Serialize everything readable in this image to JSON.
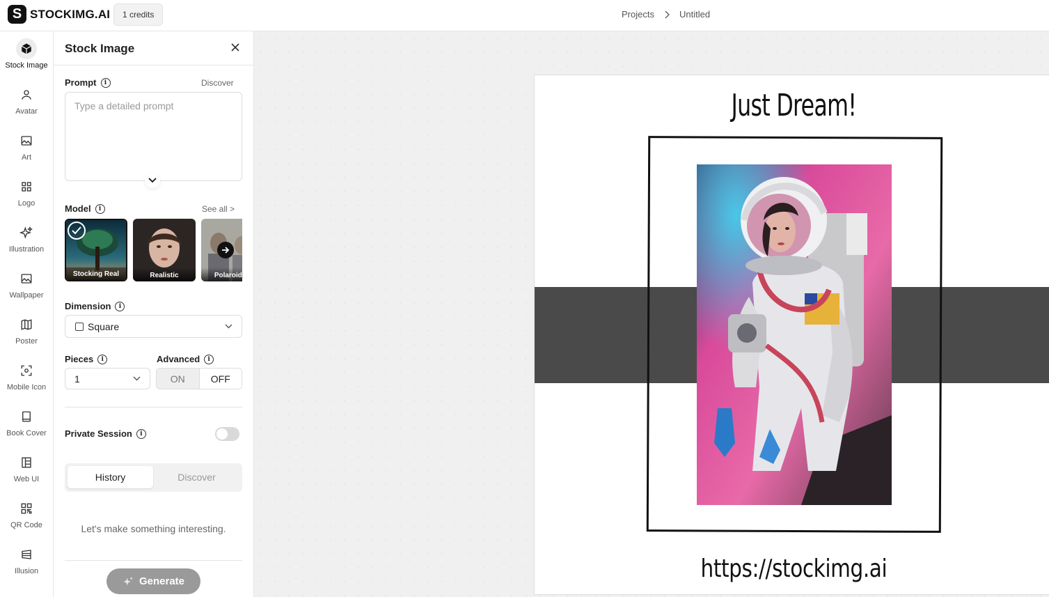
{
  "header": {
    "brand": "STOCKIMG.AI",
    "brand_mark": "S",
    "credits": "1 credits",
    "breadcrumb": [
      "Projects",
      "Untitled"
    ]
  },
  "rail": {
    "items": [
      {
        "label": "Stock Image",
        "icon": "cube-icon",
        "active": true
      },
      {
        "label": "Avatar",
        "icon": "user-icon",
        "active": false
      },
      {
        "label": "Art",
        "icon": "image-icon",
        "active": false
      },
      {
        "label": "Logo",
        "icon": "grid-icon",
        "active": false
      },
      {
        "label": "Illustration",
        "icon": "sparkles-icon",
        "active": false
      },
      {
        "label": "Wallpaper",
        "icon": "image-icon",
        "active": false
      },
      {
        "label": "Poster",
        "icon": "map-icon",
        "active": false
      },
      {
        "label": "Mobile Icon",
        "icon": "scan-icon",
        "active": false
      },
      {
        "label": "Book Cover",
        "icon": "book-icon",
        "active": false
      },
      {
        "label": "Web UI",
        "icon": "layout-icon",
        "active": false
      },
      {
        "label": "QR Code",
        "icon": "qr-icon",
        "active": false
      },
      {
        "label": "Illusion",
        "icon": "illusion-icon",
        "active": false
      }
    ]
  },
  "panel": {
    "title": "Stock Image",
    "prompt": {
      "label": "Prompt",
      "discover": "Discover",
      "placeholder": "Type a detailed prompt",
      "value": ""
    },
    "model": {
      "label": "Model",
      "see_all": "See all >",
      "options": [
        {
          "name": "Stocking Real",
          "selected": true
        },
        {
          "name": "Realistic",
          "selected": false
        },
        {
          "name": "Polaroid Pi",
          "selected": false
        }
      ]
    },
    "dimension": {
      "label": "Dimension",
      "value": "Square"
    },
    "pieces": {
      "label": "Pieces",
      "value": "1"
    },
    "advanced": {
      "label": "Advanced",
      "on": "ON",
      "off": "OFF",
      "selected": "OFF"
    },
    "private_session": {
      "label": "Private Session",
      "enabled": false
    },
    "tabs": {
      "active": "History",
      "inactive": "Discover"
    },
    "empty_message": "Let's make something interesting.",
    "generate": "Generate"
  },
  "canvas": {
    "title": "Just Dream!",
    "url": "https://stockimg.ai"
  },
  "colors": {
    "accent": "#111111",
    "band": "#4a4a4a",
    "canvas_bg": "#f0f0f0"
  }
}
